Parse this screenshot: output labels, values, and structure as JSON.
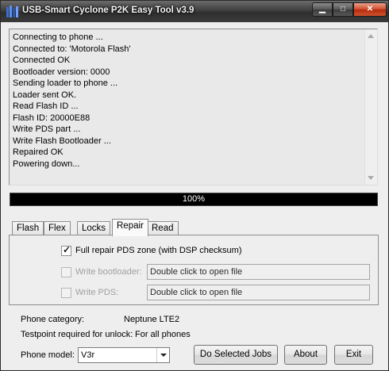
{
  "window": {
    "title": "USB-Smart Cyclone  P2K Easy Tool v3.9",
    "controls": {
      "minimize": "▁",
      "maximize": "□",
      "close": "✕"
    }
  },
  "log": {
    "lines": [
      "Connecting to phone ...",
      "Connected to: 'Motorola Flash'",
      "Connected OK",
      "Bootloader version: 0000",
      "Sending loader to phone ...",
      "Loader sent OK.",
      "Read Flash ID ...",
      "Flash ID: 20000E88",
      "Write PDS part ...",
      "Write Flash Bootloader ...",
      "Repaired OK",
      "Powering down..."
    ]
  },
  "progress": {
    "value": 1.0,
    "label": "100%"
  },
  "tabs": [
    {
      "label": "Flash",
      "active": false
    },
    {
      "label": "Flex",
      "active": false
    },
    {
      "label": "Locks",
      "active": false
    },
    {
      "label": "Repair",
      "active": true
    },
    {
      "label": "Read",
      "active": false
    }
  ],
  "repair": {
    "full_repair": {
      "label": "Full repair PDS zone (with DSP checksum)",
      "checked": true
    },
    "write_bootloader": {
      "label": "Write bootloader:",
      "value": "Double click to open file",
      "enabled": false
    },
    "write_pds": {
      "label": "Write PDS:",
      "value": "Double click to open file",
      "enabled": false
    }
  },
  "info": {
    "phone_category_label": "Phone category:",
    "phone_category_value": "Neptune LTE2",
    "testpoint_label": "Testpoint required for unlock:",
    "testpoint_value": "For all phones"
  },
  "phone_model": {
    "label": "Phone model:",
    "selected": "V3r"
  },
  "buttons": {
    "do_jobs": "Do Selected Jobs",
    "about": "About",
    "exit": "Exit"
  },
  "colors": {
    "accent_progress": "#000000",
    "titlebar": "#3f3f3f",
    "close": "#c8391a"
  }
}
